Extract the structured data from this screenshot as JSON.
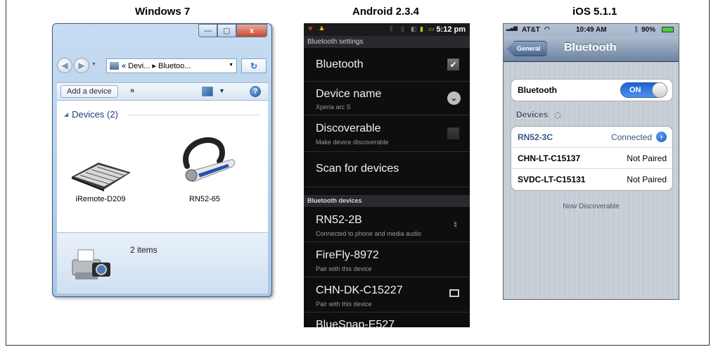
{
  "captions": {
    "windows": "Windows 7",
    "android": "Android 2.3.4",
    "ios": "iOS 5.1.1"
  },
  "windows": {
    "window_buttons": {
      "minimize": "—",
      "maximize": "▢",
      "close": "x"
    },
    "address": "« Devi... ▸ Bluetoo...",
    "toolbar": {
      "add_device": "Add a device",
      "more": "»"
    },
    "group_header": "Devices (2)",
    "devices": [
      {
        "label": "iRemote-D209",
        "icon": "keyboard-icon"
      },
      {
        "label": "RN52-65",
        "icon": "headset-icon"
      }
    ],
    "details_count": "2 items"
  },
  "android": {
    "status_time": "5:12 pm",
    "screen_title": "Bluetooth settings",
    "rows": {
      "bluetooth": "Bluetooth",
      "device_name": "Device name",
      "device_name_sub": "Xperia arc S",
      "discoverable": "Discoverable",
      "discoverable_sub": "Make device discoverable",
      "scan": "Scan for devices"
    },
    "section_devices": "Bluetooth devices",
    "devices": [
      {
        "name": "RN52-2B",
        "sub": "Connected to phone and media audio",
        "icon": "headset-icon"
      },
      {
        "name": "FireFly-8972",
        "sub": "Pair with this device"
      },
      {
        "name": "CHN-DK-C15227",
        "sub": "Pair with this device",
        "icon": "computer-icon"
      },
      {
        "name": "BlueSnap-E527"
      }
    ]
  },
  "ios": {
    "carrier": "AT&T",
    "time": "10:49 AM",
    "battery": "90%",
    "back_label": "General",
    "nav_title": "Bluetooth",
    "bluetooth_label": "Bluetooth",
    "switch_label": "ON",
    "devices_header": "Devices",
    "devices": [
      {
        "name": "RN52-3C",
        "status": "Connected"
      },
      {
        "name": "CHN-LT-C15137",
        "status": "Not Paired"
      },
      {
        "name": "SVDC-LT-C15131",
        "status": "Not Paired"
      }
    ],
    "footer": "Now Discoverable",
    "colors": {
      "accent_blue": "#2f6ad0",
      "connected_text": "#385487"
    }
  }
}
